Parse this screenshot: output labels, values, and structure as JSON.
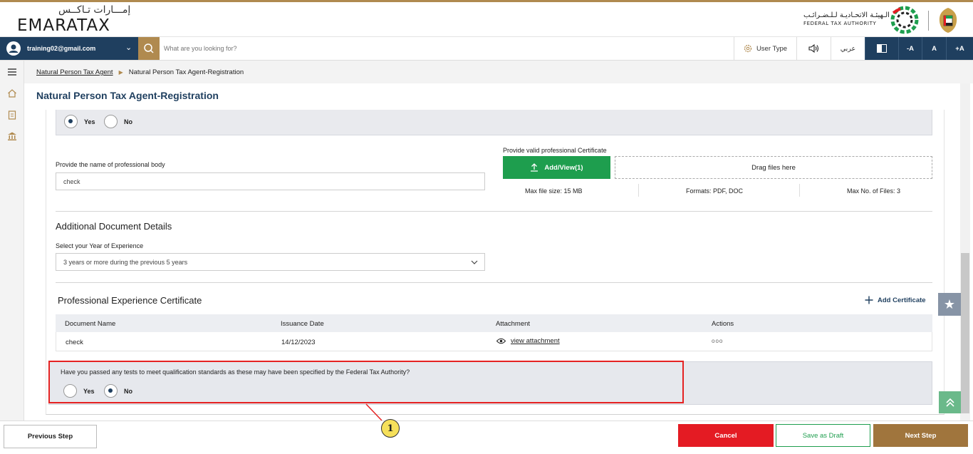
{
  "brand": {
    "logo_arabic": "إمـــارات تـاكــس",
    "logo_english": "EMARATAX",
    "authority_arabic": "الـهيئـة الاتحـاديـة لـلـضـرائـب",
    "authority_english": "FEDERAL TAX AUTHORITY"
  },
  "navbar": {
    "user_email": "training02@gmail.com",
    "search_placeholder": "What are you looking for?",
    "user_type_label": "User Type",
    "language_label": "عربي",
    "font_decrease": "-A",
    "font_normal": "A",
    "font_increase": "+A"
  },
  "breadcrumb": {
    "parent": "Natural Person Tax Agent",
    "current": "Natural Person Tax Agent-Registration"
  },
  "page_title": "Natural Person Tax Agent-Registration",
  "membership_question": {
    "options": [
      "Yes",
      "No"
    ],
    "selected": "Yes"
  },
  "professional_body": {
    "label": "Provide the name of professional body",
    "value": "check"
  },
  "certificate_upload": {
    "label": "Provide valid professional Certificate",
    "button_label": "Add/View(1)",
    "drop_text": "Drag files here",
    "max_size": "Max file size: 15 MB",
    "formats": "Formats: PDF, DOC",
    "max_files": "Max No. of Files: 3"
  },
  "additional_docs": {
    "heading": "Additional Document Details",
    "experience_label": "Select your Year of Experience",
    "experience_value": "3 years or more during the previous 5 years"
  },
  "experience_certificate": {
    "heading": "Professional Experience Certificate",
    "add_label": "Add Certificate",
    "columns": [
      "Document Name",
      "Issuance Date",
      "Attachment",
      "Actions"
    ],
    "rows": [
      {
        "document_name": "check",
        "issuance_date": "14/12/2023",
        "attachment": "view attachment",
        "actions": "ooo"
      }
    ]
  },
  "qualification_question": {
    "text": "Have you passed any tests to meet qualification standards as these may have been specified by the Federal Tax Authority?",
    "options": [
      "Yes",
      "No"
    ],
    "selected": "No"
  },
  "callout": {
    "number": "1"
  },
  "footer": {
    "previous": "Previous Step",
    "cancel": "Cancel",
    "save_draft": "Save as Draft",
    "next": "Next Step"
  },
  "colors": {
    "navy": "#1f3f5f",
    "gold": "#b08a4f",
    "green": "#1e9e4e",
    "red": "#e41b23",
    "highlight": "#e52222"
  }
}
